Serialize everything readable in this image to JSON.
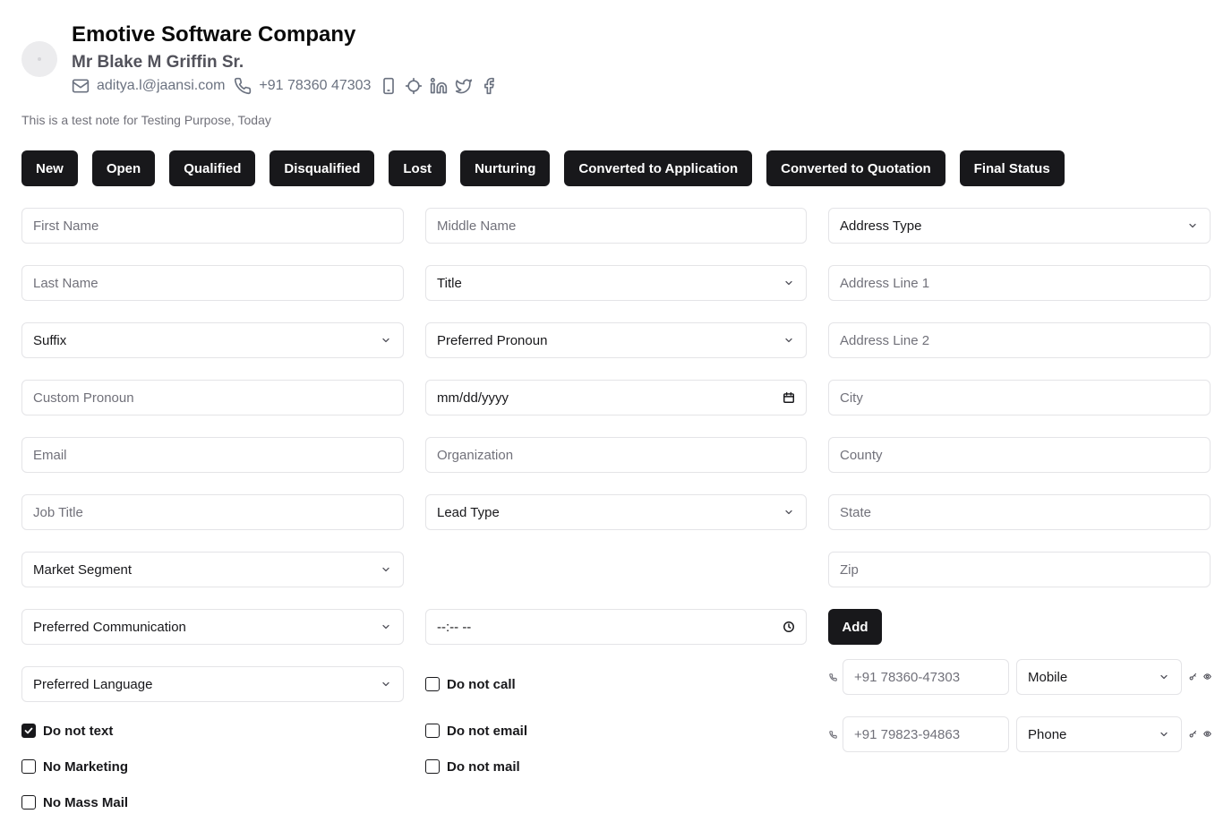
{
  "header": {
    "company": "Emotive Software Company",
    "person": "Mr Blake M Griffin Sr.",
    "email": "aditya.l@jaansi.com",
    "phone": "+91 78360 47303"
  },
  "note": "This is a test note for Testing Purpose, Today",
  "statuses": [
    "New",
    "Open",
    "Qualified",
    "Disqualified",
    "Lost",
    "Nurturing",
    "Converted to Application",
    "Converted to Quotation",
    "Final Status"
  ],
  "form": {
    "first_name": "First Name",
    "middle_name": "Middle Name",
    "address_type": "Address Type",
    "last_name": "Last Name",
    "title": "Title",
    "address_line_1": "Address Line 1",
    "suffix": "Suffix",
    "preferred_pronoun": "Preferred Pronoun",
    "address_line_2": "Address Line 2",
    "custom_pronoun": "Custom Pronoun",
    "date": "mm/dd/yyyy",
    "city": "City",
    "email": "Email",
    "organization": "Organization",
    "county": "County",
    "job_title": "Job Title",
    "lead_type": "Lead Type",
    "state": "State",
    "market_segment": "Market Segment",
    "zip": "Zip",
    "preferred_communication": "Preferred Communication",
    "time": "--:-- --",
    "add_label": "Add",
    "preferred_language": "Preferred Language"
  },
  "checkboxes": {
    "do_not_call": {
      "label": "Do not call",
      "checked": false
    },
    "do_not_text": {
      "label": "Do not text",
      "checked": true
    },
    "do_not_email": {
      "label": "Do not email",
      "checked": false
    },
    "no_marketing": {
      "label": "No Marketing",
      "checked": false
    },
    "do_not_mail": {
      "label": "Do not mail",
      "checked": false
    },
    "no_mass_mail": {
      "label": "No Mass Mail",
      "checked": false
    }
  },
  "phones": [
    {
      "number": "+91 78360-47303",
      "type": "Mobile"
    },
    {
      "number": "+91 79823-94863",
      "type": "Phone"
    }
  ],
  "icons": [
    "mail-icon",
    "phone-icon",
    "mobile-icon",
    "location-icon",
    "linkedin-icon",
    "twitter-icon",
    "facebook-icon",
    "chevron-down-icon",
    "calendar-icon",
    "clock-icon",
    "check-icon",
    "key-icon",
    "eye-icon"
  ]
}
